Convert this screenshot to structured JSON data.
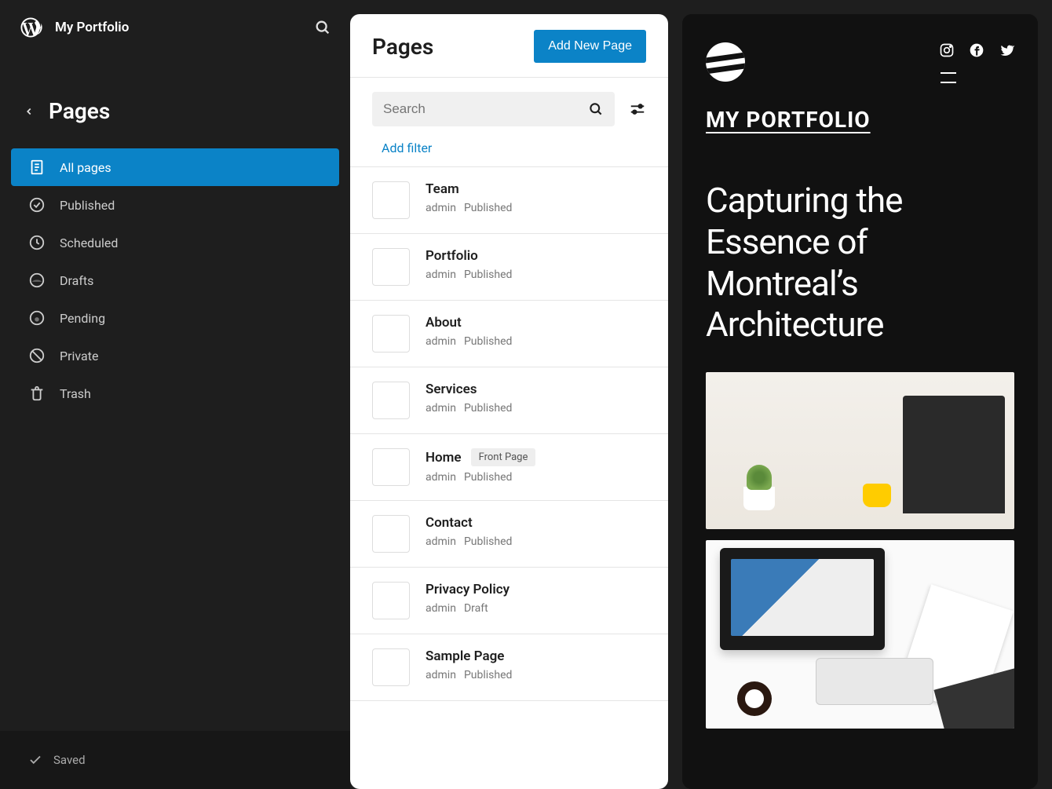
{
  "site": {
    "title": "My Portfolio"
  },
  "breadcrumb": {
    "title": "Pages"
  },
  "sidebar": {
    "items": [
      {
        "label": "All pages"
      },
      {
        "label": "Published"
      },
      {
        "label": "Scheduled"
      },
      {
        "label": "Drafts"
      },
      {
        "label": "Pending"
      },
      {
        "label": "Private"
      },
      {
        "label": "Trash"
      }
    ]
  },
  "status": {
    "label": "Saved"
  },
  "panel": {
    "title": "Pages",
    "add_button": "Add New Page",
    "search_placeholder": "Search",
    "add_filter": "Add filter"
  },
  "pages": [
    {
      "title": "Team",
      "author": "admin",
      "status": "Published",
      "badge": ""
    },
    {
      "title": "Portfolio",
      "author": "admin",
      "status": "Published",
      "badge": ""
    },
    {
      "title": "About",
      "author": "admin",
      "status": "Published",
      "badge": ""
    },
    {
      "title": "Services",
      "author": "admin",
      "status": "Published",
      "badge": ""
    },
    {
      "title": "Home",
      "author": "admin",
      "status": "Published",
      "badge": "Front Page"
    },
    {
      "title": "Contact",
      "author": "admin",
      "status": "Published",
      "badge": ""
    },
    {
      "title": "Privacy Policy",
      "author": "admin",
      "status": "Draft",
      "badge": ""
    },
    {
      "title": "Sample Page",
      "author": "admin",
      "status": "Published",
      "badge": ""
    }
  ],
  "preview": {
    "brand": "MY PORTFOLIO",
    "headline": "Capturing the Essence of Montreal’s Architecture"
  }
}
